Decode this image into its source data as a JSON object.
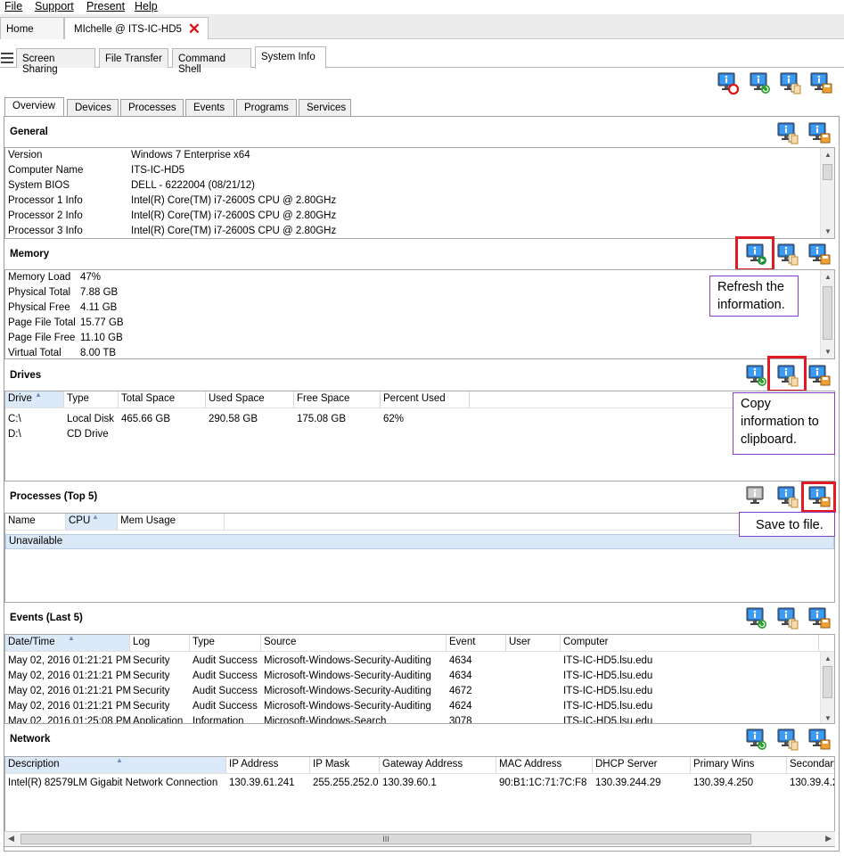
{
  "menu": [
    "File",
    "Support",
    "Present",
    "Help"
  ],
  "session_tabs": {
    "home": "Home",
    "session": "MIchelle @ ITS-IC-HD5"
  },
  "main_tabs": [
    "Screen Sharing",
    "File Transfer",
    "Command Shell",
    "System Info"
  ],
  "inner_tabs": [
    "Overview",
    "Devices",
    "Processes",
    "Events",
    "Programs",
    "Services"
  ],
  "general": {
    "title": "General",
    "rows": [
      {
        "k": "Version",
        "v": "Windows 7 Enterprise x64"
      },
      {
        "k": "Computer Name",
        "v": "ITS-IC-HD5"
      },
      {
        "k": "System BIOS",
        "v": "DELL   - 6222004  (08/21/12)"
      },
      {
        "k": "Processor 1 Info",
        "v": "Intel(R) Core(TM) i7-2600S CPU @ 2.80GHz"
      },
      {
        "k": "Processor 2 Info",
        "v": "Intel(R) Core(TM) i7-2600S CPU @ 2.80GHz"
      },
      {
        "k": "Processor 3 Info",
        "v": "Intel(R) Core(TM) i7-2600S CPU @ 2.80GHz"
      }
    ]
  },
  "memory": {
    "title": "Memory",
    "rows": [
      {
        "k": "Memory Load",
        "v": "47%"
      },
      {
        "k": "Physical Total",
        "v": "7.88 GB"
      },
      {
        "k": "Physical Free",
        "v": "4.11 GB"
      },
      {
        "k": "Page File Total",
        "v": "15.77 GB"
      },
      {
        "k": "Page File Free",
        "v": "11.10 GB"
      },
      {
        "k": "Virtual Total",
        "v": "8.00 TB"
      }
    ]
  },
  "drives": {
    "title": "Drives",
    "columns": [
      "Drive",
      "Type",
      "Total Space",
      "Used Space",
      "Free Space",
      "Percent Used"
    ],
    "rows": [
      [
        "C:\\",
        "Local Disk",
        "465.66 GB",
        "290.58 GB",
        "175.08 GB",
        "62%"
      ],
      [
        "D:\\",
        "CD Drive",
        "",
        "",
        "",
        ""
      ]
    ]
  },
  "processes": {
    "title": "Processes (Top 5)",
    "columns": [
      "Name",
      "CPU",
      "Mem Usage"
    ],
    "status": "Unavailable"
  },
  "events": {
    "title": "Events (Last 5)",
    "columns": [
      "Date/Time",
      "Log",
      "Type",
      "Source",
      "Event",
      "User",
      "Computer"
    ],
    "rows": [
      [
        "May 02, 2016 01:21:21 PM",
        "Security",
        "Audit Success",
        "Microsoft-Windows-Security-Auditing",
        "4634",
        "",
        "ITS-IC-HD5.lsu.edu"
      ],
      [
        "May 02, 2016 01:21:21 PM",
        "Security",
        "Audit Success",
        "Microsoft-Windows-Security-Auditing",
        "4634",
        "",
        "ITS-IC-HD5.lsu.edu"
      ],
      [
        "May 02, 2016 01:21:21 PM",
        "Security",
        "Audit Success",
        "Microsoft-Windows-Security-Auditing",
        "4672",
        "",
        "ITS-IC-HD5.lsu.edu"
      ],
      [
        "May 02, 2016 01:21:21 PM",
        "Security",
        "Audit Success",
        "Microsoft-Windows-Security-Auditing",
        "4624",
        "",
        "ITS-IC-HD5.lsu.edu"
      ],
      [
        "May 02, 2016 01:25:08 PM",
        "Application",
        "Information",
        "Microsoft-Windows-Search",
        "3078",
        "",
        "ITS-IC-HD5.lsu.edu"
      ]
    ]
  },
  "network": {
    "title": "Network",
    "columns": [
      "Description",
      "IP Address",
      "IP Mask",
      "Gateway Address",
      "MAC Address",
      "DHCP Server",
      "Primary Wins",
      "Secondary"
    ],
    "rows": [
      [
        "Intel(R) 82579LM Gigabit Network Connection",
        "130.39.61.241",
        "255.255.252.0",
        "130.39.60.1",
        "90:B1:1C:71:7C:F8",
        "130.39.244.29",
        "130.39.4.250",
        "130.39.4.2"
      ]
    ]
  },
  "callouts": {
    "refresh": "Refresh the information.",
    "copy": "Copy information to clipboard.",
    "save": "Save to file."
  },
  "scroll_grip": "III",
  "colors": {
    "icon_blue": "#2e7bd6",
    "highlight_red": "#e01b24",
    "callout_border": "#8b3fcf",
    "close_red": "#d11111"
  }
}
